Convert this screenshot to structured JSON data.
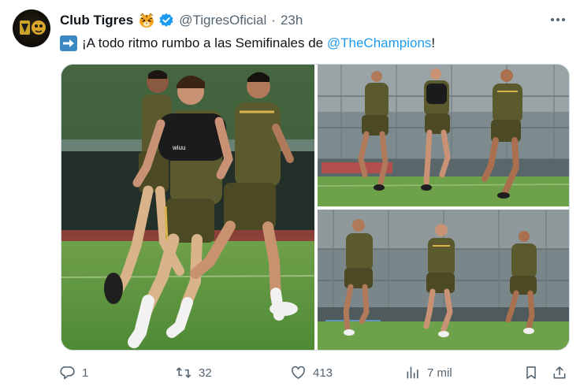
{
  "tweet": {
    "author_name": "Club Tigres",
    "handle": "@TigresOficial",
    "separator": "·",
    "time": "23h",
    "text_before": "¡A todo ritmo rumbo a las Semifinales de ",
    "mention": "@TheChampions",
    "text_after": "!",
    "icons": {
      "author_emoji": "tiger-face-icon",
      "verified": "verified-badge-icon",
      "lead_emoji": "right-arrow-emoji-icon",
      "more": "more-options-icon"
    }
  },
  "colors": {
    "accent": "#1d9bf0",
    "verified": "#1d9bf0",
    "muted": "#536471",
    "text": "#0f1419",
    "kit_olive": "#5b5a2e",
    "kit_gold": "#d9b44a"
  },
  "media": {
    "photos": [
      {
        "name": "photo-players-sprinting-closeup"
      },
      {
        "name": "photo-players-running-field-top"
      },
      {
        "name": "photo-players-running-field-bottom"
      }
    ]
  },
  "actions": {
    "replies": "1",
    "reposts": "32",
    "likes": "413",
    "views": "7 mil",
    "icons": [
      "reply-icon",
      "repost-icon",
      "like-icon",
      "views-icon",
      "bookmark-icon",
      "share-icon"
    ]
  }
}
